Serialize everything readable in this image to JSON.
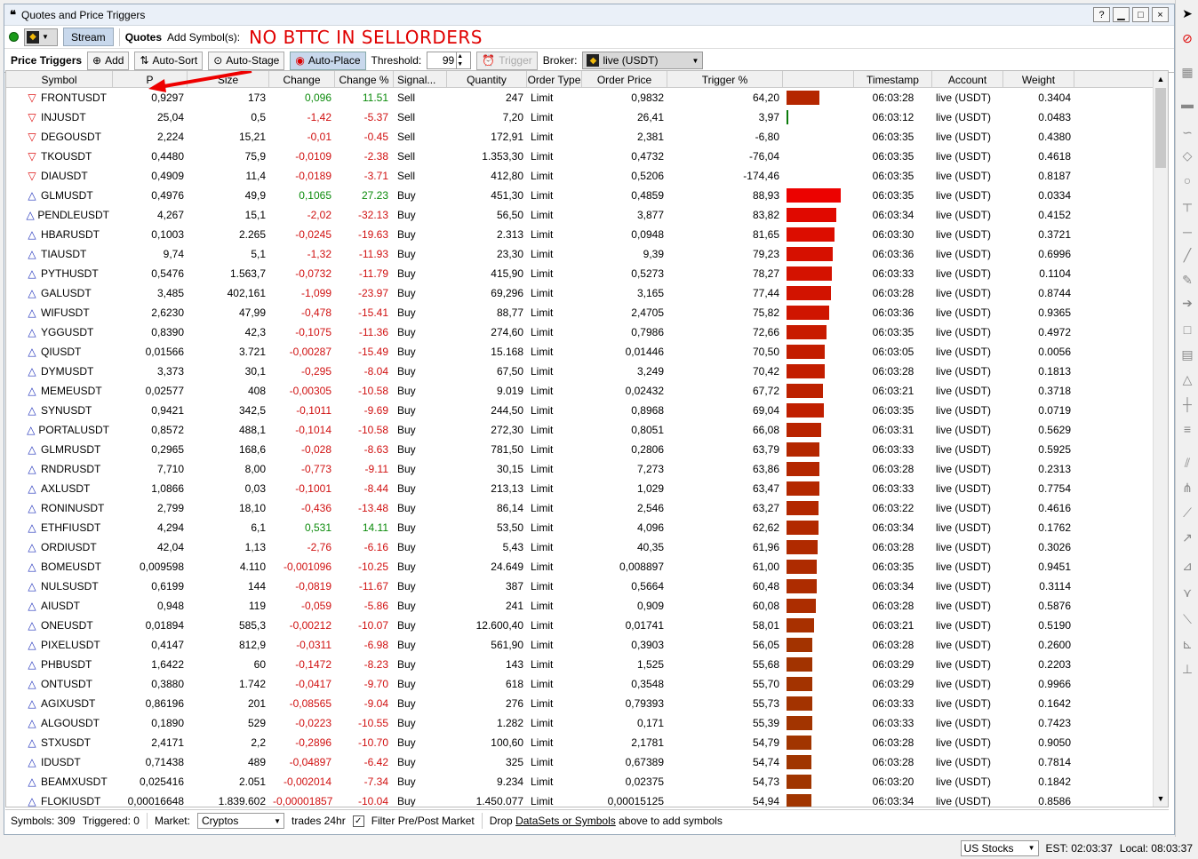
{
  "window": {
    "title": "Quotes and Price Triggers",
    "help": "?",
    "minimize": "▁",
    "maximize": "□",
    "close": "×"
  },
  "toolbar1": {
    "stream": "Stream",
    "quotes": "Quotes",
    "add_symbols": "Add Symbol(s):",
    "annotation": "NO BTTC IN SELLORDERS"
  },
  "toolbar2": {
    "title": "Price Triggers",
    "add": "Add",
    "auto_sort": "Auto-Sort",
    "auto_stage": "Auto-Stage",
    "auto_place": "Auto-Place",
    "threshold_label": "Threshold:",
    "threshold": "99",
    "trigger": "Trigger",
    "broker_label": "Broker:",
    "broker": "live (USDT)"
  },
  "columns": [
    "Symbol",
    "P",
    "Size",
    "Change",
    "Change %",
    "Signal...",
    "Quantity",
    "Order Type",
    "Order Price",
    "Trigger %",
    "",
    "Timestamp",
    "Account",
    "Weight"
  ],
  "rows": [
    [
      "dn",
      "FRONTUSDT",
      "0,9297",
      "173",
      "0,096",
      "11.51",
      "Sell",
      "247",
      "Limit",
      "0,9832",
      "64,20",
      "06:03:28",
      "live (USDT)",
      "0.3404"
    ],
    [
      "dn",
      "INJUSDT",
      "25,04",
      "0,5",
      "-1,42",
      "-5.37",
      "Sell",
      "7,20",
      "Limit",
      "26,41",
      "3,97",
      "06:03:12",
      "live (USDT)",
      "0.0483"
    ],
    [
      "dn",
      "DEGOUSDT",
      "2,224",
      "15,21",
      "-0,01",
      "-0.45",
      "Sell",
      "172,91",
      "Limit",
      "2,381",
      "-6,80",
      "06:03:35",
      "live (USDT)",
      "0.4380"
    ],
    [
      "dn",
      "TKOUSDT",
      "0,4480",
      "75,9",
      "-0,0109",
      "-2.38",
      "Sell",
      "1.353,30",
      "Limit",
      "0,4732",
      "-76,04",
      "06:03:35",
      "live (USDT)",
      "0.4618"
    ],
    [
      "dn",
      "DIAUSDT",
      "0,4909",
      "11,4",
      "-0,0189",
      "-3.71",
      "Sell",
      "412,80",
      "Limit",
      "0,5206",
      "-174,46",
      "06:03:35",
      "live (USDT)",
      "0.8187"
    ],
    [
      "up",
      "GLMUSDT",
      "0,4976",
      "49,9",
      "0,1065",
      "27.23",
      "Buy",
      "451,30",
      "Limit",
      "0,4859",
      "88,93",
      "06:03:35",
      "live (USDT)",
      "0.0334"
    ],
    [
      "up",
      "PENDLEUSDT",
      "4,267",
      "15,1",
      "-2,02",
      "-32.13",
      "Buy",
      "56,50",
      "Limit",
      "3,877",
      "83,82",
      "06:03:34",
      "live (USDT)",
      "0.4152"
    ],
    [
      "up",
      "HBARUSDT",
      "0,1003",
      "2.265",
      "-0,0245",
      "-19.63",
      "Buy",
      "2.313",
      "Limit",
      "0,0948",
      "81,65",
      "06:03:30",
      "live (USDT)",
      "0.3721"
    ],
    [
      "up",
      "TIAUSDT",
      "9,74",
      "5,1",
      "-1,32",
      "-11.93",
      "Buy",
      "23,30",
      "Limit",
      "9,39",
      "79,23",
      "06:03:36",
      "live (USDT)",
      "0.6996"
    ],
    [
      "up",
      "PYTHUSDT",
      "0,5476",
      "1.563,7",
      "-0,0732",
      "-11.79",
      "Buy",
      "415,90",
      "Limit",
      "0,5273",
      "78,27",
      "06:03:33",
      "live (USDT)",
      "0.1104"
    ],
    [
      "up",
      "GALUSDT",
      "3,485",
      "402,161",
      "-1,099",
      "-23.97",
      "Buy",
      "69,296",
      "Limit",
      "3,165",
      "77,44",
      "06:03:28",
      "live (USDT)",
      "0.8744"
    ],
    [
      "up",
      "WIFUSDT",
      "2,6230",
      "47,99",
      "-0,478",
      "-15.41",
      "Buy",
      "88,77",
      "Limit",
      "2,4705",
      "75,82",
      "06:03:36",
      "live (USDT)",
      "0.9365"
    ],
    [
      "up",
      "YGGUSDT",
      "0,8390",
      "42,3",
      "-0,1075",
      "-11.36",
      "Buy",
      "274,60",
      "Limit",
      "0,7986",
      "72,66",
      "06:03:35",
      "live (USDT)",
      "0.4972"
    ],
    [
      "up",
      "QIUSDT",
      "0,01566",
      "3.721",
      "-0,00287",
      "-15.49",
      "Buy",
      "15.168",
      "Limit",
      "0,01446",
      "70,50",
      "06:03:05",
      "live (USDT)",
      "0.0056"
    ],
    [
      "up",
      "DYMUSDT",
      "3,373",
      "30,1",
      "-0,295",
      "-8.04",
      "Buy",
      "67,50",
      "Limit",
      "3,249",
      "70,42",
      "06:03:28",
      "live (USDT)",
      "0.1813"
    ],
    [
      "up",
      "MEMEUSDT",
      "0,02577",
      "408",
      "-0,00305",
      "-10.58",
      "Buy",
      "9.019",
      "Limit",
      "0,02432",
      "67,72",
      "06:03:21",
      "live (USDT)",
      "0.3718"
    ],
    [
      "up",
      "SYNUSDT",
      "0,9421",
      "342,5",
      "-0,1011",
      "-9.69",
      "Buy",
      "244,50",
      "Limit",
      "0,8968",
      "69,04",
      "06:03:35",
      "live (USDT)",
      "0.0719"
    ],
    [
      "up",
      "PORTALUSDT",
      "0,8572",
      "488,1",
      "-0,1014",
      "-10.58",
      "Buy",
      "272,30",
      "Limit",
      "0,8051",
      "66,08",
      "06:03:31",
      "live (USDT)",
      "0.5629"
    ],
    [
      "up",
      "GLMRUSDT",
      "0,2965",
      "168,6",
      "-0,028",
      "-8.63",
      "Buy",
      "781,50",
      "Limit",
      "0,2806",
      "63,79",
      "06:03:33",
      "live (USDT)",
      "0.5925"
    ],
    [
      "up",
      "RNDRUSDT",
      "7,710",
      "8,00",
      "-0,773",
      "-9.11",
      "Buy",
      "30,15",
      "Limit",
      "7,273",
      "63,86",
      "06:03:28",
      "live (USDT)",
      "0.2313"
    ],
    [
      "up",
      "AXLUSDT",
      "1,0866",
      "0,03",
      "-0,1001",
      "-8.44",
      "Buy",
      "213,13",
      "Limit",
      "1,029",
      "63,47",
      "06:03:33",
      "live (USDT)",
      "0.7754"
    ],
    [
      "up",
      "RONINUSDT",
      "2,799",
      "18,10",
      "-0,436",
      "-13.48",
      "Buy",
      "86,14",
      "Limit",
      "2,546",
      "63,27",
      "06:03:22",
      "live (USDT)",
      "0.4616"
    ],
    [
      "up",
      "ETHFIUSDT",
      "4,294",
      "6,1",
      "0,531",
      "14.11",
      "Buy",
      "53,50",
      "Limit",
      "4,096",
      "62,62",
      "06:03:34",
      "live (USDT)",
      "0.1762"
    ],
    [
      "up",
      "ORDIUSDT",
      "42,04",
      "1,13",
      "-2,76",
      "-6.16",
      "Buy",
      "5,43",
      "Limit",
      "40,35",
      "61,96",
      "06:03:28",
      "live (USDT)",
      "0.3026"
    ],
    [
      "up",
      "BOMEUSDT",
      "0,009598",
      "4.110",
      "-0,001096",
      "-10.25",
      "Buy",
      "24.649",
      "Limit",
      "0,008897",
      "61,00",
      "06:03:35",
      "live (USDT)",
      "0.9451"
    ],
    [
      "up",
      "NULSUSDT",
      "0,6199",
      "144",
      "-0,0819",
      "-11.67",
      "Buy",
      "387",
      "Limit",
      "0,5664",
      "60,48",
      "06:03:34",
      "live (USDT)",
      "0.3114"
    ],
    [
      "up",
      "AIUSDT",
      "0,948",
      "119",
      "-0,059",
      "-5.86",
      "Buy",
      "241",
      "Limit",
      "0,909",
      "60,08",
      "06:03:28",
      "live (USDT)",
      "0.5876"
    ],
    [
      "up",
      "ONEUSDT",
      "0,01894",
      "585,3",
      "-0,00212",
      "-10.07",
      "Buy",
      "12.600,40",
      "Limit",
      "0,01741",
      "58,01",
      "06:03:21",
      "live (USDT)",
      "0.5190"
    ],
    [
      "up",
      "PIXELUSDT",
      "0,4147",
      "812,9",
      "-0,0311",
      "-6.98",
      "Buy",
      "561,90",
      "Limit",
      "0,3903",
      "56,05",
      "06:03:28",
      "live (USDT)",
      "0.2600"
    ],
    [
      "up",
      "PHBUSDT",
      "1,6422",
      "60",
      "-0,1472",
      "-8.23",
      "Buy",
      "143",
      "Limit",
      "1,525",
      "55,68",
      "06:03:29",
      "live (USDT)",
      "0.2203"
    ],
    [
      "up",
      "ONTUSDT",
      "0,3880",
      "1.742",
      "-0,0417",
      "-9.70",
      "Buy",
      "618",
      "Limit",
      "0,3548",
      "55,70",
      "06:03:29",
      "live (USDT)",
      "0.9966"
    ],
    [
      "up",
      "AGIXUSDT",
      "0,86196",
      "201",
      "-0,08565",
      "-9.04",
      "Buy",
      "276",
      "Limit",
      "0,79393",
      "55,73",
      "06:03:33",
      "live (USDT)",
      "0.1642"
    ],
    [
      "up",
      "ALGOUSDT",
      "0,1890",
      "529",
      "-0,0223",
      "-10.55",
      "Buy",
      "1.282",
      "Limit",
      "0,171",
      "55,39",
      "06:03:33",
      "live (USDT)",
      "0.7423"
    ],
    [
      "up",
      "STXUSDT",
      "2,4171",
      "2,2",
      "-0,2896",
      "-10.70",
      "Buy",
      "100,60",
      "Limit",
      "2,1781",
      "54,79",
      "06:03:28",
      "live (USDT)",
      "0.9050"
    ],
    [
      "up",
      "IDUSDT",
      "0,71438",
      "489",
      "-0,04897",
      "-6.42",
      "Buy",
      "325",
      "Limit",
      "0,67389",
      "54,74",
      "06:03:28",
      "live (USDT)",
      "0.7814"
    ],
    [
      "up",
      "BEAMXUSDT",
      "0,025416",
      "2.051",
      "-0,002014",
      "-7.34",
      "Buy",
      "9.234",
      "Limit",
      "0,02375",
      "54,73",
      "06:03:20",
      "live (USDT)",
      "0.1842"
    ],
    [
      "up",
      "FLOKIUSDT",
      "0,00016648",
      "1.839.602",
      "-0,00001857",
      "-10.04",
      "Buy",
      "1.450.077",
      "Limit",
      "0,00015125",
      "54,94",
      "06:03:34",
      "live (USDT)",
      "0.8586"
    ]
  ],
  "status": {
    "symbols": "Symbols: 309",
    "triggered": "Triggered: 0",
    "market_label": "Market:",
    "market": "Cryptos",
    "trades": "trades 24hr",
    "filter": "Filter Pre/Post Market",
    "drop_a": "Drop ",
    "drop_link": "DataSets or Symbols",
    "drop_b": " above to add symbols"
  },
  "bottom": {
    "region": "US Stocks",
    "est": "EST: 02:03:37",
    "local": "Local: 08:03:37"
  }
}
